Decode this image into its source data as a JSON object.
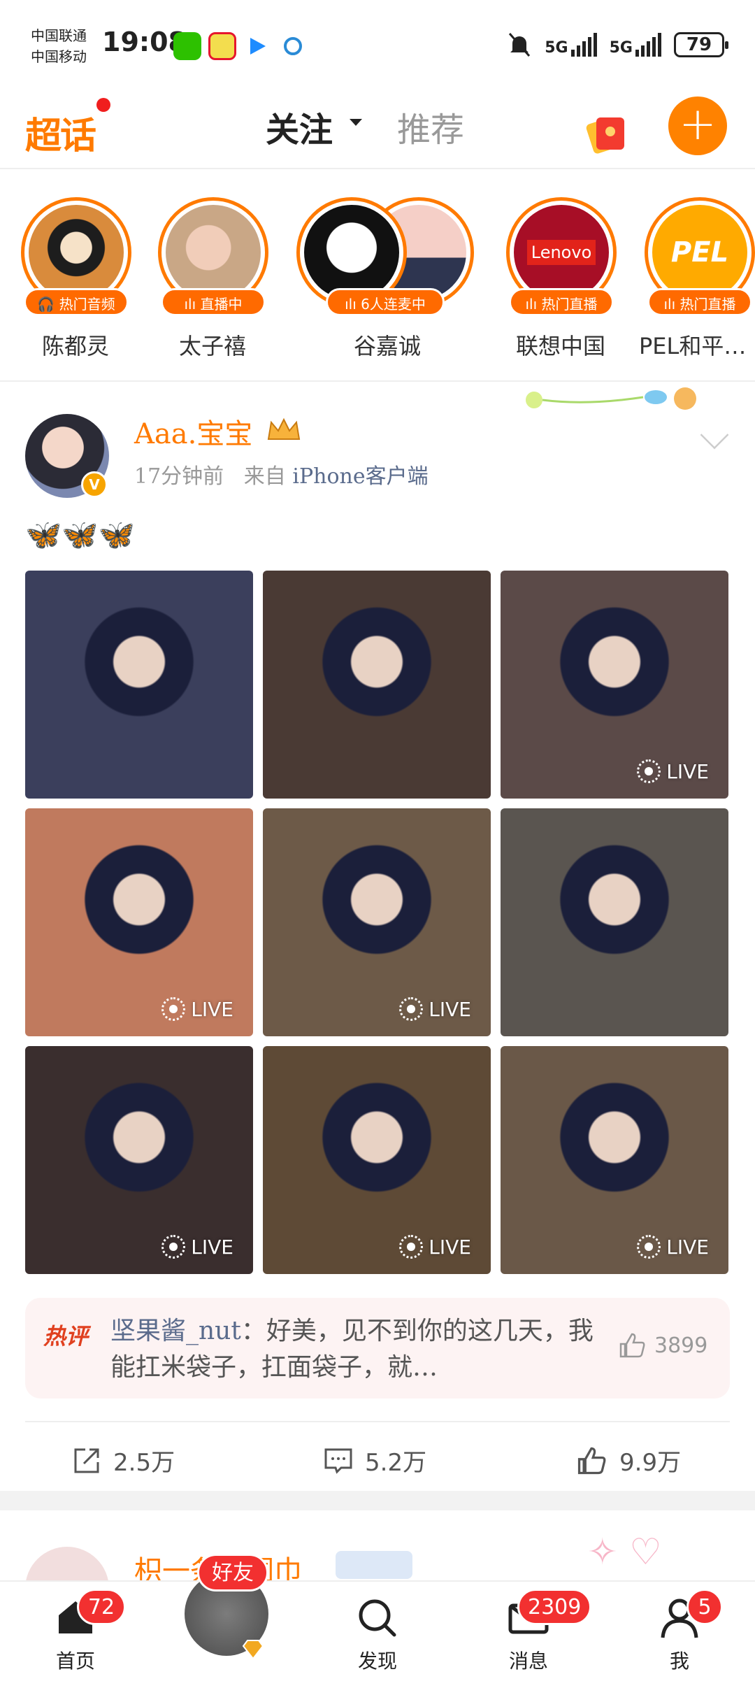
{
  "status_bar": {
    "carrier_1": "中国联通",
    "carrier_2": "中国移动",
    "time": "19:08",
    "net_1": "5G",
    "net_2": "5G",
    "battery": "79"
  },
  "header": {
    "logo": "超话",
    "tab_follow": "关注",
    "tab_recommend": "推荐"
  },
  "stories": [
    {
      "name": "陈都灵",
      "badge": "热门音频",
      "color": "#f2a25a"
    },
    {
      "name": "太子禧",
      "badge": "直播中",
      "color": "#e7c7a8"
    },
    {
      "name": "谷嘉诚",
      "badge": "6人连麦中",
      "color": "#2c2c2c"
    },
    {
      "name": "联想中国",
      "badge": "热门直播",
      "color": "#b0122b",
      "logo_text": "Lenovo"
    },
    {
      "name": "PEL和平…",
      "badge": "热门直播",
      "color": "#ffaa00",
      "logo_text": "PEL"
    }
  ],
  "post": {
    "author": "Aaa.宝宝",
    "time": "17分钟前",
    "source_prefix": "来自",
    "source": "iPhone客户端",
    "text": "🦋🦋🦋",
    "live_label": "LIVE",
    "photos": [
      {
        "color": "#3b3f5c",
        "live": false
      },
      {
        "color": "#4a3a34",
        "live": false
      },
      {
        "color": "#5b4a48",
        "live": true
      },
      {
        "color": "#c07a5e",
        "live": true
      },
      {
        "color": "#6d5a48",
        "live": true
      },
      {
        "color": "#5a5550",
        "live": false
      },
      {
        "color": "#3a2e2e",
        "live": true
      },
      {
        "color": "#5e4a36",
        "live": true
      },
      {
        "color": "#6a5848",
        "live": true
      }
    ],
    "hot_comment": {
      "tag": "热评",
      "user": "坚果酱_nut",
      "text": "：好美，见不到你的这几天，我能扛米袋子，扛面袋子，就…",
      "likes": "3899"
    },
    "shares": "2.5万",
    "comments": "5.2万",
    "likes": "9.9万"
  },
  "next_post": {
    "author": "枳一条棉围巾"
  },
  "bottom_nav": [
    {
      "label": "首页",
      "count": "72"
    },
    {
      "label": "",
      "count": "好友"
    },
    {
      "label": "发现",
      "count": ""
    },
    {
      "label": "消息",
      "count": "2309"
    },
    {
      "label": "我",
      "count": "5"
    }
  ]
}
